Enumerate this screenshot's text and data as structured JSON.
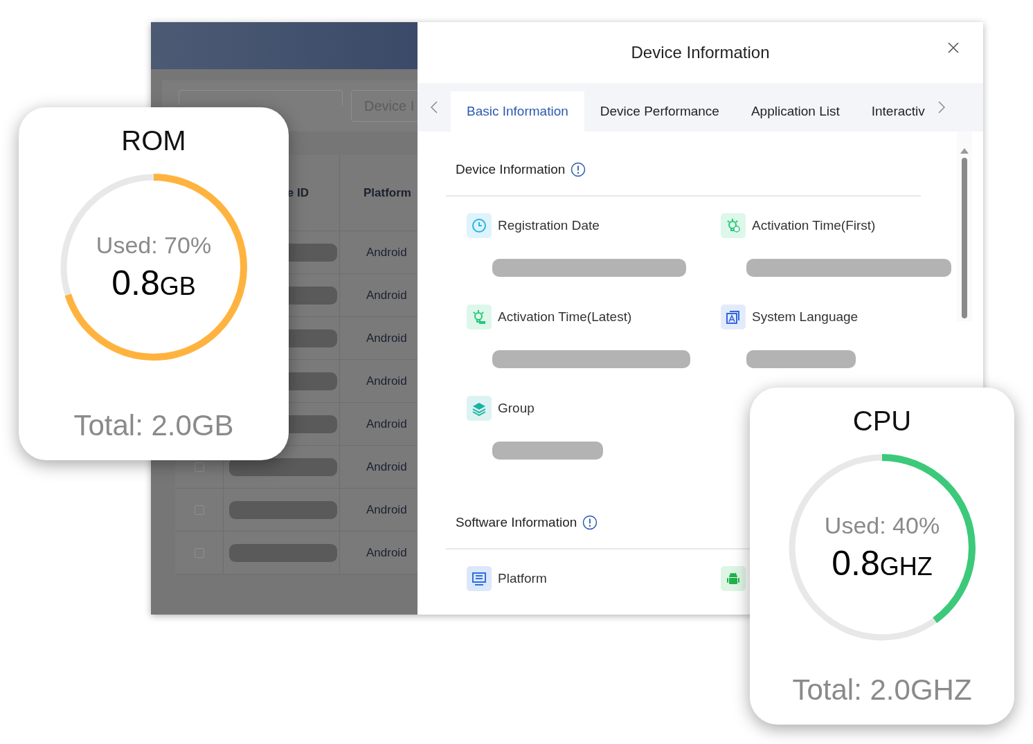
{
  "backdrop": {
    "filter_input": {
      "placeholder": "Device I"
    },
    "table": {
      "columns": [
        "e ID",
        "Platform"
      ],
      "rows": [
        {
          "platform": "Android"
        },
        {
          "platform": "Android"
        },
        {
          "platform": "Android"
        },
        {
          "platform": "Android"
        },
        {
          "platform": "Android"
        },
        {
          "platform": "Android",
          "checked": false
        },
        {
          "platform": "Android",
          "checked": false
        },
        {
          "platform": "Android",
          "checked": false
        }
      ]
    }
  },
  "drawer": {
    "title": "Device Information",
    "tabs": [
      {
        "label": "Basic Information",
        "selected": true
      },
      {
        "label": "Device Performance",
        "selected": false
      },
      {
        "label": "Application List",
        "selected": false
      },
      {
        "label": "Interactiv",
        "selected": false
      }
    ],
    "sections": [
      {
        "title": "Device Information",
        "items": [
          {
            "kind": "clock",
            "label": "Registration Date"
          },
          {
            "kind": "bulb",
            "label": "Activation Time(First)"
          },
          {
            "kind": "bulb-new",
            "label": "Activation Time(Latest)"
          },
          {
            "kind": "language",
            "label": "System Language"
          },
          {
            "kind": "layers",
            "label": "Group"
          }
        ]
      },
      {
        "title": "Software Information",
        "items": [
          {
            "kind": "monitor",
            "label": "Platform"
          },
          {
            "kind": "android"
          }
        ]
      }
    ]
  },
  "cards": [
    {
      "title": "ROM",
      "used": "Used: 70%",
      "value": "0.8",
      "unit": "GB",
      "total": "Total: 2.0GB",
      "level": 0.7,
      "color": "#ffb33f"
    },
    {
      "title": "CPU",
      "used": "Used: 40%",
      "value": "0.8",
      "unit": "GHZ",
      "total": "Total: 2.0GHZ",
      "level": 0.4,
      "color": "#3cc97a"
    }
  ]
}
